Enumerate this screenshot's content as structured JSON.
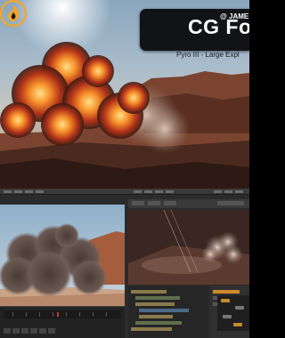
{
  "brand": {
    "username": "@ JAME",
    "title": "CG For",
    "subtitle": "Pyro III - Large Expl",
    "accent": "#f6a623",
    "badge_bg": "#111316"
  },
  "icons": {
    "logo": "fire-flame-icon"
  },
  "scenes": {
    "hero": "explosion-render",
    "viewport_left": "smoke-plume-viewport",
    "viewport_right": "dust-cloud-viewport"
  }
}
